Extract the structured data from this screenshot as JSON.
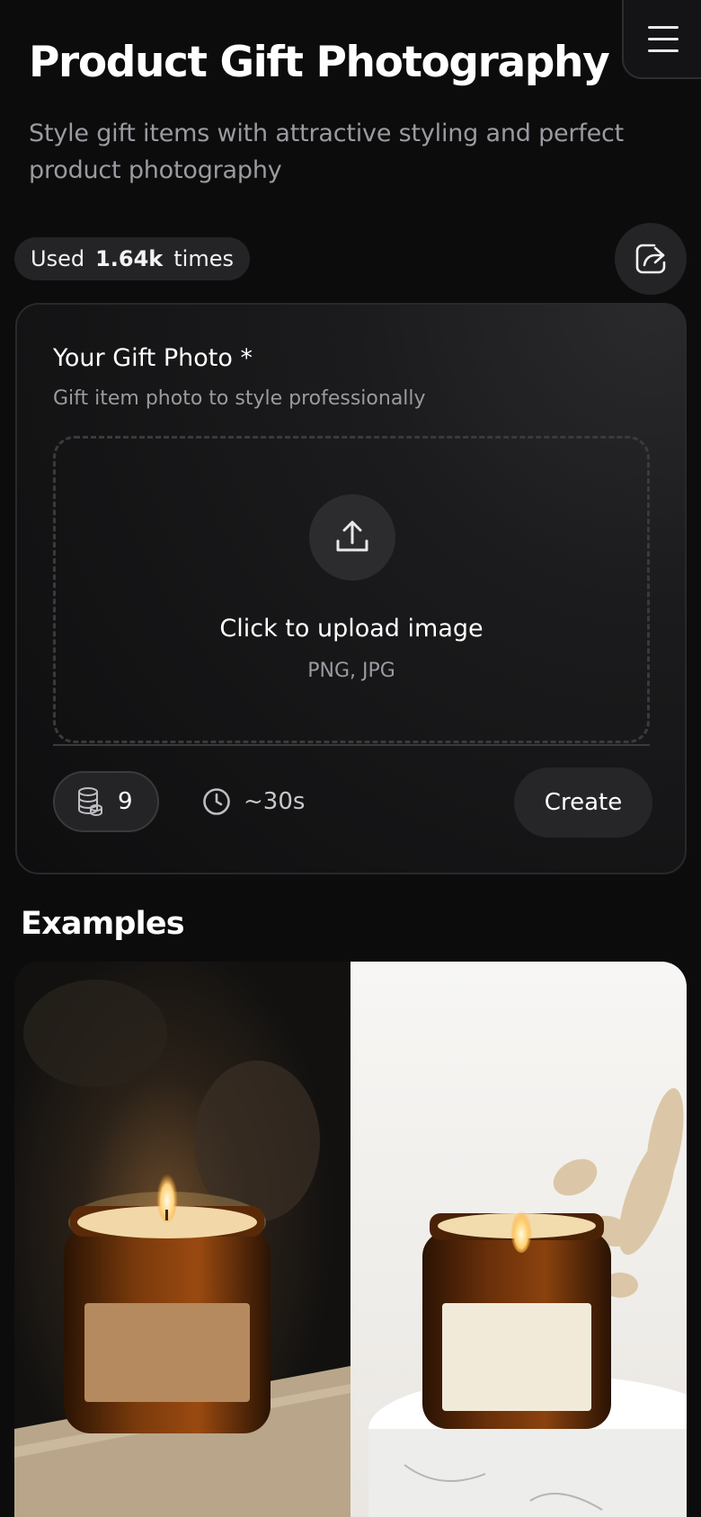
{
  "header": {
    "title": "Product Gift Photography",
    "subtitle": "Style gift items with attractive styling and perfect product photography",
    "menu_icon": "hamburger-menu-icon"
  },
  "usage": {
    "prefix": "Used",
    "count": "1.64k",
    "suffix": "times"
  },
  "share": {
    "icon": "share-icon"
  },
  "form": {
    "field_label": "Your Gift Photo *",
    "field_description": "Gift item photo to style professionally",
    "upload": {
      "title": "Click to upload image",
      "hint": "PNG, JPG",
      "icon": "upload-icon"
    },
    "credits": {
      "icon": "coins-icon",
      "value": "9"
    },
    "duration": {
      "icon": "clock-icon",
      "value": "~30s"
    },
    "create_label": "Create"
  },
  "examples": {
    "heading": "Examples",
    "images": [
      {
        "name": "example-before-image",
        "description": "candle photo"
      },
      {
        "name": "example-after-image",
        "description": "styled candle photo"
      }
    ]
  },
  "colors": {
    "background": "#0c0c0d",
    "surface": "#242427",
    "text_muted": "#9a9aa0"
  }
}
